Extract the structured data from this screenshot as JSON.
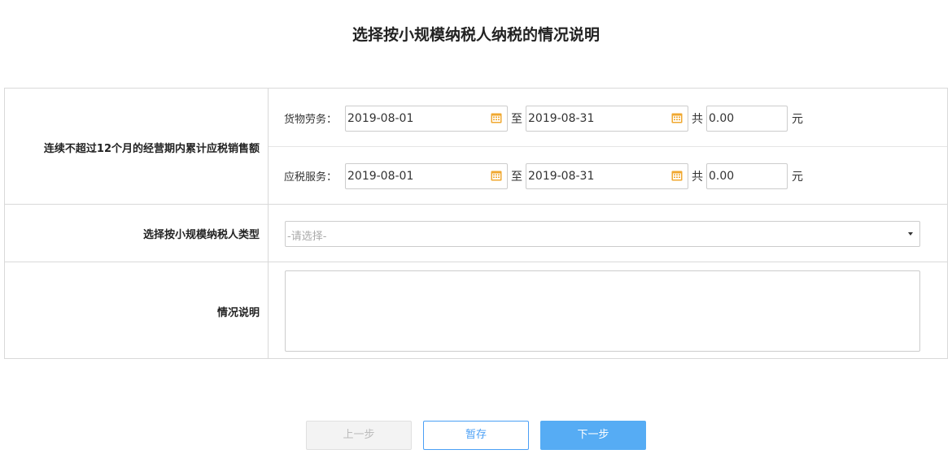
{
  "page": {
    "title": "选择按小规模纳税人纳税的情况说明"
  },
  "sales": {
    "label": "连续不超过12个月的经营期内累计应税销售额",
    "goods": {
      "label": "货物劳务：",
      "start_date": "2019-08-01",
      "to": "至",
      "end_date": "2019-08-31",
      "total_prefix": "共",
      "amount": "0.00",
      "unit": "元"
    },
    "services": {
      "label": "应税服务：",
      "start_date": "2019-08-01",
      "to": "至",
      "end_date": "2019-08-31",
      "total_prefix": "共",
      "amount": "0.00",
      "unit": "元"
    }
  },
  "type_select": {
    "label": "选择按小规模纳税人类型",
    "placeholder": "-请选择-"
  },
  "description": {
    "label": "情况说明",
    "value": ""
  },
  "buttons": {
    "prev": "上一步",
    "save": "暂存",
    "next": "下一步"
  },
  "colors": {
    "primary": "#56acf4",
    "calendar_icon": "#f0a830",
    "border": "#d9d9d9"
  }
}
